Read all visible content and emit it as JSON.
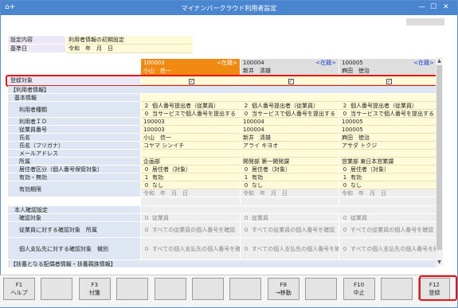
{
  "titlebar": {
    "title": "マイナンバークラウド利用者設定",
    "left_icons": "⌂+",
    "minimize": "—",
    "maximize": "☐",
    "close": "✕"
  },
  "settings": {
    "label1": "設定内容",
    "value1": "利用者情報の初期設定",
    "label2": "基準日",
    "era": "令和",
    "year": "年",
    "month": "月",
    "day": "日"
  },
  "headers": [
    {
      "id": "100003",
      "link": "<在籍>",
      "name": "小山　信一"
    },
    {
      "id": "100004",
      "link": "<在籍>",
      "name": "新井　清雄"
    },
    {
      "id": "100005",
      "link": "<在籍>",
      "name": "麻田　徳治"
    }
  ],
  "labels": {
    "register_target": "登録対象",
    "user_info": "【利用者情報】",
    "basic_info": "基本情報",
    "user_type": "利用者種類",
    "user_id": "利用者ＩＤ",
    "employee_no": "従業員番号",
    "name": "氏名",
    "name_kana": "氏名（フリガナ）",
    "email": "メールアドレス",
    "dept": "所属",
    "residence": "居住者区分（個人番号保管対象）",
    "valid": "有効・無効",
    "valid_period": "有効期限",
    "identity": "本人確認設定",
    "confirm_target": "確認対象",
    "confirm_dept": "従業員に対する確認対象　所属",
    "confirm_individual": "個人支払先に対する確認対象　機別",
    "dependents": "【扶養となる配偶者情報・扶養親族情報】"
  },
  "rows": {
    "type1": [
      {
        "n": "2",
        "t": "個人番号提出者（従業員）"
      },
      {
        "n": "2",
        "t": "個人番号提出者（従業員）"
      },
      {
        "n": "2",
        "t": "個人番号提出者（従業員）"
      }
    ],
    "type2": [
      {
        "n": "0",
        "t": "当サービスで個人番号を提出する"
      },
      {
        "n": "0",
        "t": "当サービスで個人番号を提出する"
      },
      {
        "n": "0",
        "t": "当サービスで個人番号を提出する"
      }
    ],
    "user_id": [
      "100003",
      "100004",
      "100005"
    ],
    "employee_no": [
      "100003",
      "100004",
      "100005"
    ],
    "name": [
      "小山　信一",
      "新井　清雄",
      "麻田　徳治"
    ],
    "kana": [
      "コヤマ シンイチ",
      "アライ キヨオ",
      "アサダ トクジ"
    ],
    "dept": [
      "企画部",
      "開発部 第一開発課",
      "営業部 東日本営業課"
    ],
    "residence": [
      {
        "n": "0",
        "t": "居住者（対象）"
      },
      {
        "n": "0",
        "t": "居住者（対象）"
      },
      {
        "n": "0",
        "t": "居住者（対象）"
      }
    ],
    "valid": [
      {
        "n": "1",
        "t": "有効"
      },
      {
        "n": "1",
        "t": "有効"
      },
      {
        "n": "1",
        "t": "有効"
      }
    ],
    "valid2": [
      {
        "n": "0",
        "t": "なし"
      },
      {
        "n": "0",
        "t": "なし"
      },
      {
        "n": "0",
        "t": "なし"
      }
    ],
    "period": [
      "令和　年　月　日",
      "令和　年　月　日",
      "令和　年　月　日"
    ],
    "confirm_target": [
      {
        "n": "0",
        "t": "従業員"
      },
      {
        "n": "0",
        "t": "従業員"
      },
      {
        "n": "0",
        "t": "従業員"
      }
    ],
    "confirm_dept": [
      {
        "n": "0",
        "t": "すべての従業員の個人番号を確認"
      },
      {
        "n": "0",
        "t": "すべての従業員の個人番号を確認"
      },
      {
        "n": "0",
        "t": "すべての従業員の個人番号を確認"
      }
    ],
    "confirm_ind": [
      {
        "n": "0",
        "t": "すべての個人支払先の個人番号を確"
      },
      {
        "n": "0",
        "t": "すべての個人支払先の個人番号を確"
      },
      {
        "n": "0",
        "t": "すべての個人支払先の個人番号を確"
      }
    ]
  },
  "fkeys": [
    {
      "key": "F1",
      "label": "ヘルプ"
    },
    {
      "key": "",
      "label": ""
    },
    {
      "key": "F3",
      "label": "付箋"
    },
    {
      "key": "",
      "label": ""
    },
    {
      "key": "",
      "label": ""
    },
    {
      "key": "",
      "label": ""
    },
    {
      "key": "",
      "label": ""
    },
    {
      "key": "F8",
      "label": "→移動"
    },
    {
      "key": "",
      "label": ""
    },
    {
      "key": "F10",
      "label": "中止"
    },
    {
      "key": "",
      "label": ""
    },
    {
      "key": "F12",
      "label": "登録"
    }
  ],
  "colors": {
    "accent": "#4a86cf",
    "selected_header": "#f08a12",
    "highlight": "#e11111"
  }
}
